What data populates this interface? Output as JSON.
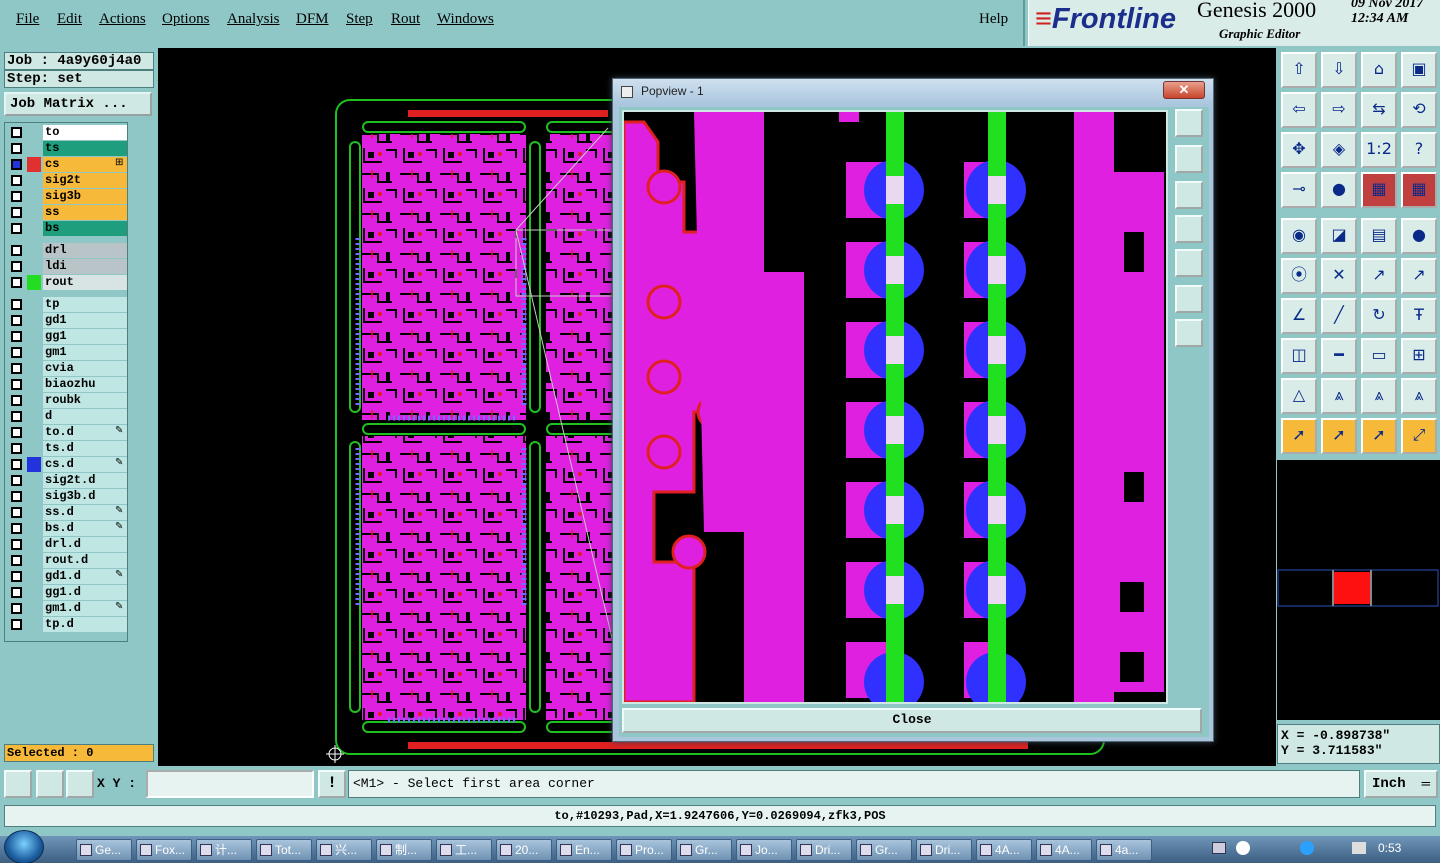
{
  "menu": {
    "items": [
      "File",
      "Edit",
      "Actions",
      "Options",
      "Analysis",
      "DFM",
      "Step",
      "Rout",
      "Windows"
    ],
    "help": "Help"
  },
  "logo": {
    "brand": "Frontline",
    "product": "Genesis 2000",
    "subtitle": "Graphic Editor",
    "date": "09 Nov 2017",
    "time": "12:34 AM"
  },
  "left_panel": {
    "job": "Job : 4a9y60j4a0",
    "step": "Step: set",
    "job_matrix_button": "Job Matrix ...",
    "selected": "Selected : 0"
  },
  "layers": [
    {
      "name": "to",
      "color": "#ffffff",
      "check_color": "#8fc7c7",
      "flag": ""
    },
    {
      "name": "ts",
      "color": "#1e9e7c",
      "check_color": "#8fc7c7",
      "flag": ""
    },
    {
      "name": "cs",
      "color": "#f6b93a",
      "check_color": "#e03030",
      "flag": "⊞",
      "active": true
    },
    {
      "name": "sig2t",
      "color": "#f6b93a",
      "check_color": "#8fc7c7",
      "flag": ""
    },
    {
      "name": "sig3b",
      "color": "#f6b93a",
      "check_color": "#8fc7c7",
      "flag": ""
    },
    {
      "name": "ss",
      "color": "#f6b93a",
      "check_color": "#8fc7c7",
      "flag": ""
    },
    {
      "name": "bs",
      "color": "#1e9e7c",
      "check_color": "#8fc7c7",
      "flag": ""
    },
    {
      "name": "drl",
      "color": "#b8c4c8",
      "check_color": "#8fc7c7",
      "flag": "",
      "gap": true
    },
    {
      "name": "ldi",
      "color": "#b8c4c8",
      "check_color": "#8fc7c7",
      "flag": ""
    },
    {
      "name": "rout",
      "color": "#d8e4e4",
      "check_color": "#22dd22",
      "flag": ""
    },
    {
      "name": "tp",
      "color": "#bfe6e2",
      "check_color": "#8fc7c7",
      "flag": "",
      "gap": true
    },
    {
      "name": "gd1",
      "color": "#bfe6e2",
      "check_color": "#8fc7c7",
      "flag": ""
    },
    {
      "name": "gg1",
      "color": "#bfe6e2",
      "check_color": "#8fc7c7",
      "flag": ""
    },
    {
      "name": "gm1",
      "color": "#bfe6e2",
      "check_color": "#8fc7c7",
      "flag": ""
    },
    {
      "name": "cvia",
      "color": "#bfe6e2",
      "check_color": "#8fc7c7",
      "flag": ""
    },
    {
      "name": "biaozhu",
      "color": "#bfe6e2",
      "check_color": "#8fc7c7",
      "flag": ""
    },
    {
      "name": "roubk",
      "color": "#bfe6e2",
      "check_color": "#8fc7c7",
      "flag": ""
    },
    {
      "name": "d",
      "color": "#bfe6e2",
      "check_color": "#8fc7c7",
      "flag": ""
    },
    {
      "name": "to.d",
      "color": "#bfe6e2",
      "check_color": "#8fc7c7",
      "flag": "✎"
    },
    {
      "name": "ts.d",
      "color": "#bfe6e2",
      "check_color": "#8fc7c7",
      "flag": ""
    },
    {
      "name": "cs.d",
      "color": "#bfe6e2",
      "check_color": "#2233dd",
      "flag": "✎"
    },
    {
      "name": "sig2t.d",
      "color": "#bfe6e2",
      "check_color": "#8fc7c7",
      "flag": ""
    },
    {
      "name": "sig3b.d",
      "color": "#bfe6e2",
      "check_color": "#8fc7c7",
      "flag": ""
    },
    {
      "name": "ss.d",
      "color": "#bfe6e2",
      "check_color": "#8fc7c7",
      "flag": "✎"
    },
    {
      "name": "bs.d",
      "color": "#bfe6e2",
      "check_color": "#8fc7c7",
      "flag": "✎"
    },
    {
      "name": "drl.d",
      "color": "#bfe6e2",
      "check_color": "#8fc7c7",
      "flag": ""
    },
    {
      "name": "rout.d",
      "color": "#bfe6e2",
      "check_color": "#8fc7c7",
      "flag": ""
    },
    {
      "name": "gd1.d",
      "color": "#bfe6e2",
      "check_color": "#8fc7c7",
      "flag": "✎"
    },
    {
      "name": "gg1.d",
      "color": "#bfe6e2",
      "check_color": "#8fc7c7",
      "flag": ""
    },
    {
      "name": "gm1.d",
      "color": "#bfe6e2",
      "check_color": "#8fc7c7",
      "flag": "✎"
    },
    {
      "name": "tp.d",
      "color": "#bfe6e2",
      "check_color": "#8fc7c7",
      "flag": ""
    }
  ],
  "popview": {
    "title": "Popview - 1",
    "close_label": "Close",
    "close_x": "✕"
  },
  "right_panel": {
    "coord_x": "X = -0.898738\"",
    "coord_y": "Y = 3.711583\""
  },
  "toolbar_icons": [
    "zoom-home-icon",
    "zoom-in-box-icon",
    "home-icon",
    "window-icon",
    "pan-left-icon",
    "pan-right-icon",
    "flip-icon",
    "redraw-icon",
    "fit-icon",
    "center-icon",
    "scale-icon",
    "help-icon",
    "measure-icon",
    "snap-icon",
    "layers-icon",
    "layers-alt-icon",
    "pad-icon",
    "line-icon",
    "ruler-icon",
    "point-icon",
    "connect-icon",
    "cross-icon",
    "move-icon",
    "move-alt-icon",
    "angle-icon",
    "slash-icon",
    "rotate-icon",
    "text-icon",
    "select-box-icon",
    "divider-icon",
    "align-icon",
    "group-icon",
    "triangle-icon",
    "triangle-a-icon",
    "triangle-b-icon",
    "triangle-c-icon",
    "cursor-icon",
    "cursor-box-icon",
    "cursor-alt-icon",
    "route-icon"
  ],
  "command": {
    "xy_label": "X Y :",
    "xy_value": "",
    "alert_icon": "!",
    "prompt": "<M1> - Select first area corner",
    "units": "Inch"
  },
  "status": {
    "text": "to,#10293,Pad,X=1.9247606,Y=0.0269094,zfk3,POS"
  },
  "taskbar": {
    "items": [
      "Ge...",
      "Fox...",
      "计...",
      "Tot...",
      "兴...",
      "制...",
      "工...",
      "20...",
      "En...",
      "Pro...",
      "Gr...",
      "Jo...",
      "Dri...",
      "Gr...",
      "Dri...",
      "4A...",
      "4A...",
      "4a..."
    ],
    "clock": "0:53"
  }
}
